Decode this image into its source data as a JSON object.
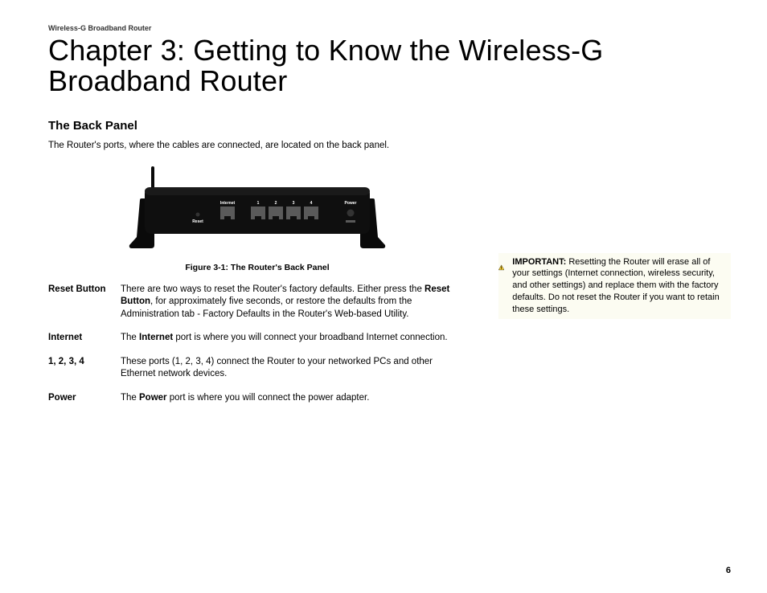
{
  "header": {
    "running": "Wireless-G Broadband Router"
  },
  "chapter": {
    "title": "Chapter 3: Getting to Know the Wireless-G Broadband Router"
  },
  "section": {
    "title": "The Back Panel",
    "intro": "The Router's ports, where the cables are connected, are located on the back panel."
  },
  "figure": {
    "caption": "Figure 3-1: The Router's Back Panel",
    "labels": {
      "reset": "Reset",
      "internet": "Internet",
      "p1": "1",
      "p2": "2",
      "p3": "3",
      "p4": "4",
      "power": "Power"
    }
  },
  "definitions": [
    {
      "term": "Reset Button",
      "desc_pre": "There are two ways to reset the Router's factory defaults. Either press the ",
      "desc_bold": "Reset Button",
      "desc_post": ", for approximately five seconds, or restore the defaults from the Administration tab - Factory Defaults in the Router's Web-based Utility."
    },
    {
      "term": "Internet",
      "desc_pre": "The ",
      "desc_bold": "Internet",
      "desc_post": " port is where you will connect your broadband Internet connection."
    },
    {
      "term": "1, 2, 3, 4",
      "desc_pre": "",
      "desc_bold": "",
      "desc_post": "These ports (1, 2, 3, 4) connect the Router to your networked PCs and other Ethernet network devices."
    },
    {
      "term": "Power",
      "desc_pre": "The ",
      "desc_bold": "Power",
      "desc_post": " port is where you will connect the power adapter."
    }
  ],
  "note": {
    "label": "IMPORTANT:",
    "text": " Resetting the Router will erase all of your settings (Internet connection, wireless security, and other settings) and replace them with the factory defaults. Do not reset the Router if you want to retain these settings."
  },
  "page_number": "6"
}
